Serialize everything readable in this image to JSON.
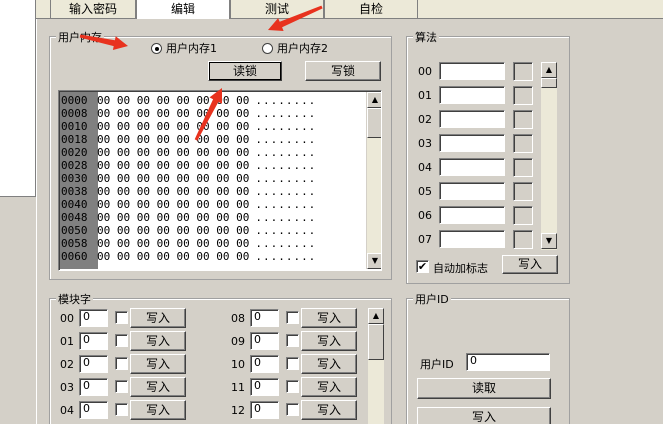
{
  "tabs": [
    "输入密码",
    "编辑",
    "测试",
    "自检"
  ],
  "user_memory": {
    "title": "用户内存",
    "radio1": "用户内存1",
    "radio2": "用户内存2",
    "read_btn": "读锁",
    "write_btn": "写锁",
    "rows": [
      {
        "addr": "0000",
        "hex": "00 00 00 00 00 00 00 00",
        "ascii": "........"
      },
      {
        "addr": "0008",
        "hex": "00 00 00 00 00 00 00 00",
        "ascii": "........"
      },
      {
        "addr": "0010",
        "hex": "00 00 00 00 00 00 00 00",
        "ascii": "........"
      },
      {
        "addr": "0018",
        "hex": "00 00 00 00 00 00 00 00",
        "ascii": "........"
      },
      {
        "addr": "0020",
        "hex": "00 00 00 00 00 00 00 00",
        "ascii": "........"
      },
      {
        "addr": "0028",
        "hex": "00 00 00 00 00 00 00 00",
        "ascii": "........"
      },
      {
        "addr": "0030",
        "hex": "00 00 00 00 00 00 00 00",
        "ascii": "........"
      },
      {
        "addr": "0038",
        "hex": "00 00 00 00 00 00 00 00",
        "ascii": "........"
      },
      {
        "addr": "0040",
        "hex": "00 00 00 00 00 00 00 00",
        "ascii": "........"
      },
      {
        "addr": "0048",
        "hex": "00 00 00 00 00 00 00 00",
        "ascii": "........"
      },
      {
        "addr": "0050",
        "hex": "00 00 00 00 00 00 00 00",
        "ascii": "........"
      },
      {
        "addr": "0058",
        "hex": "00 00 00 00 00 00 00 00",
        "ascii": "........"
      },
      {
        "addr": "0060",
        "hex": "00 00 00 00 00 00 00 00",
        "ascii": "........"
      }
    ]
  },
  "algorithm": {
    "title": "算法",
    "rows": [
      "00",
      "01",
      "02",
      "03",
      "04",
      "05",
      "06",
      "07"
    ],
    "auto_flag_label": "自动加标志",
    "auto_flag_checked": "✔",
    "write_btn": "写入"
  },
  "module_words": {
    "title": "模块字",
    "left": [
      {
        "idx": "00",
        "value": "0",
        "btn": "写入"
      },
      {
        "idx": "01",
        "value": "0",
        "btn": "写入"
      },
      {
        "idx": "02",
        "value": "0",
        "btn": "写入"
      },
      {
        "idx": "03",
        "value": "0",
        "btn": "写入"
      },
      {
        "idx": "04",
        "value": "0",
        "btn": "写入"
      }
    ],
    "right": [
      {
        "idx": "08",
        "value": "0",
        "btn": "写入"
      },
      {
        "idx": "09",
        "value": "0",
        "btn": "写入"
      },
      {
        "idx": "10",
        "value": "0",
        "btn": "写入"
      },
      {
        "idx": "11",
        "value": "0",
        "btn": "写入"
      },
      {
        "idx": "12",
        "value": "0",
        "btn": "写入"
      }
    ]
  },
  "user_id": {
    "title": "用户ID",
    "label": "用户ID",
    "value": "0",
    "read_btn": "读取",
    "write_btn": "写入"
  },
  "colors": {
    "arrow": "#e8321e",
    "face": "#d4d0c8"
  },
  "icons": {
    "scroll_up": "▲",
    "scroll_down": "▼"
  }
}
